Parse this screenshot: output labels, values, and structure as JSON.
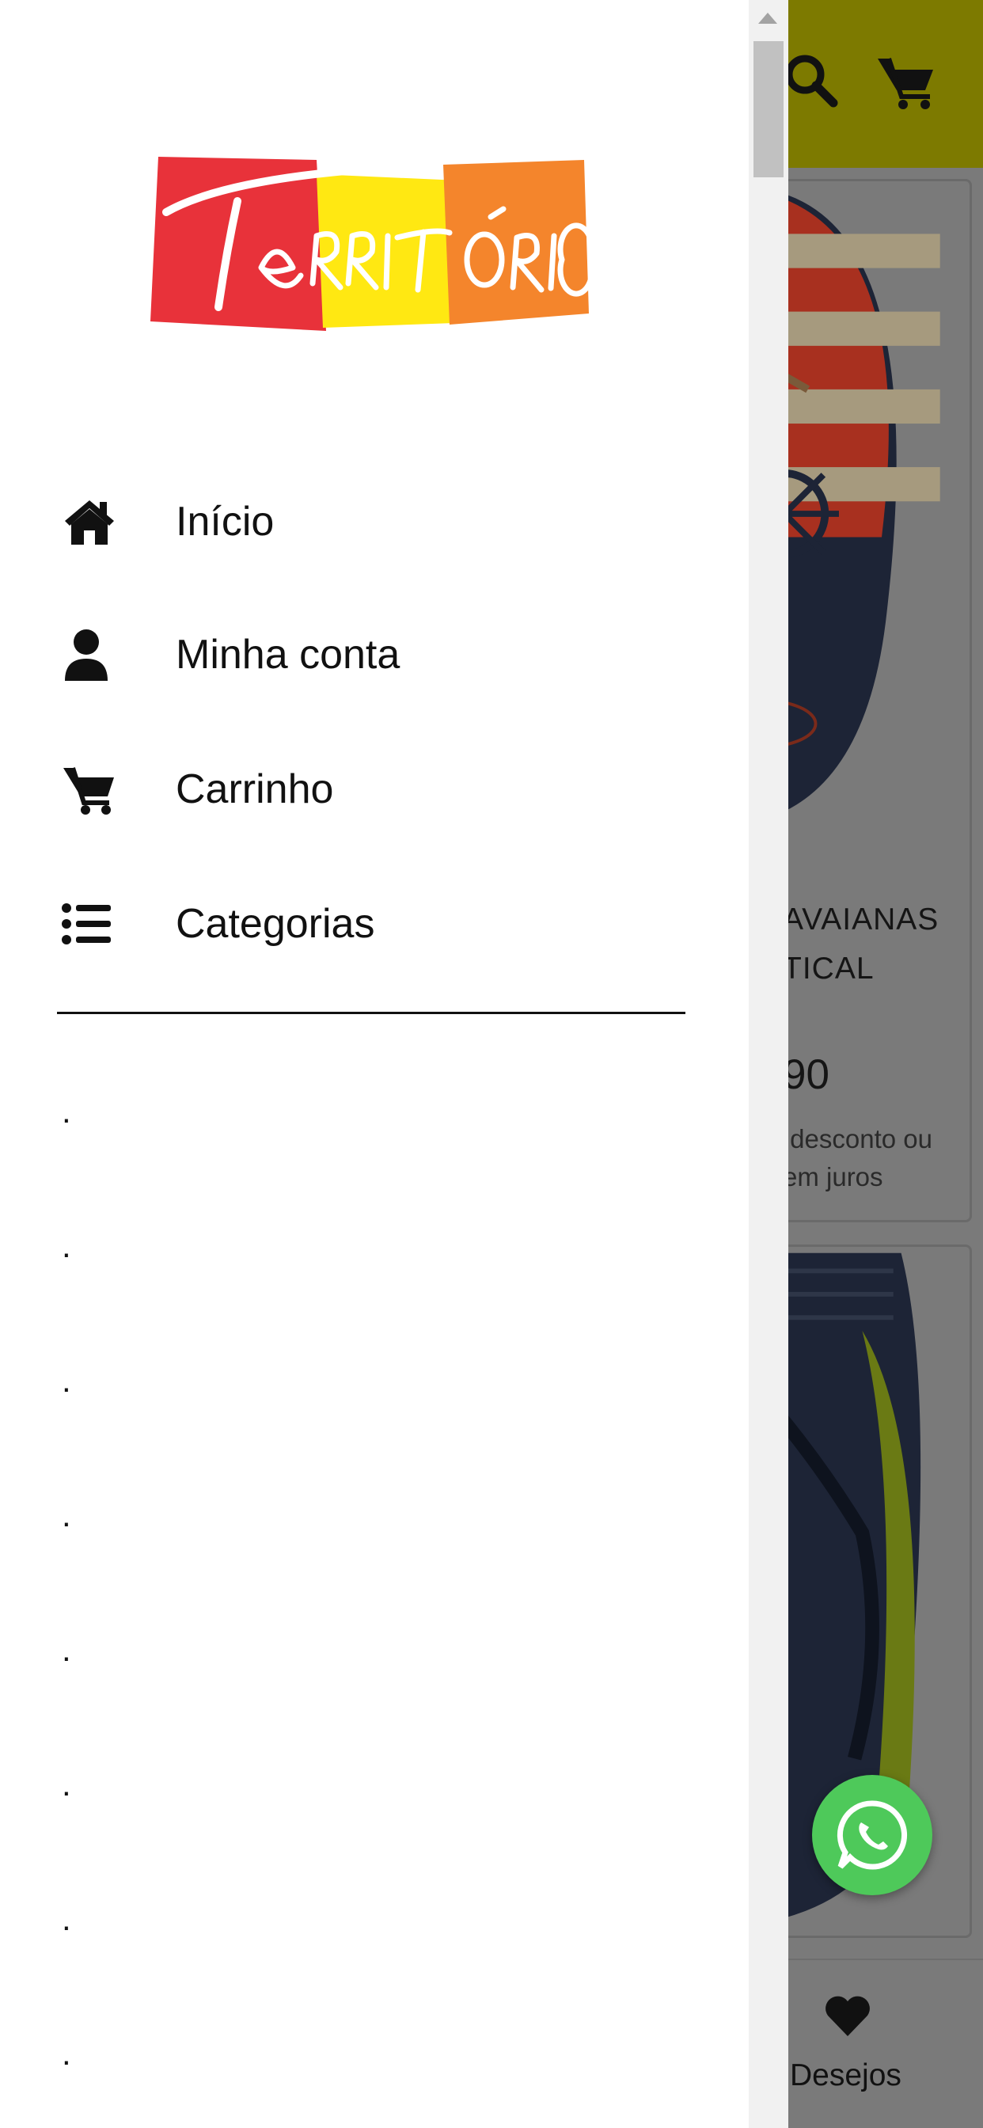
{
  "drawer": {
    "logo_text": "Território",
    "menu": [
      {
        "label": "Início",
        "icon": "home-icon"
      },
      {
        "label": "Minha conta",
        "icon": "user-icon"
      },
      {
        "label": "Carrinho",
        "icon": "cart-icon"
      },
      {
        "label": "Categorias",
        "icon": "list-icon"
      }
    ],
    "category_items": [
      ".",
      ".",
      ".",
      ".",
      ".",
      ".",
      ".",
      "."
    ]
  },
  "background": {
    "header_icons": [
      "search-icon",
      "cart-icon"
    ],
    "products": [
      {
        "title_partial": "AVAIANAS\nTICAL",
        "price_partial": "90",
        "note_partial": " desconto ou\nem juros"
      }
    ],
    "bottom_nav": {
      "wishlist_label": "Desejos"
    },
    "floating_button": "whatsapp-icon"
  },
  "colors": {
    "header": "#7d7a00",
    "overlay_dim": "#7a7a7a",
    "whatsapp": "#4ec95a",
    "logo_red": "#e8323a",
    "logo_yellow": "#ffe812",
    "logo_orange": "#f4852c"
  }
}
